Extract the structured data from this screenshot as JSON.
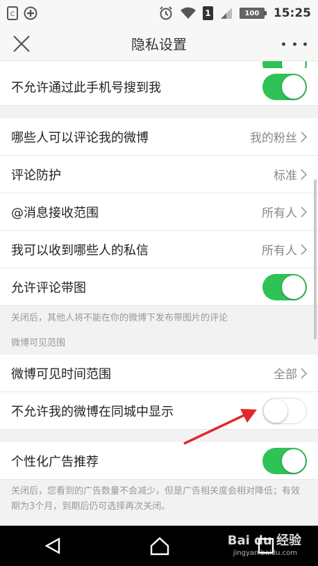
{
  "status_bar": {
    "time": "15:25",
    "battery": "100",
    "sim": "1"
  },
  "navbar": {
    "title": "隐私设置",
    "close_icon": "close-icon",
    "more_icon": "more-icon"
  },
  "settings": {
    "phone_search": {
      "label": "不允许通过此手机号搜到我",
      "toggle": true
    },
    "comment_who": {
      "label": "哪些人可以评论我的微博",
      "value": "我的粉丝"
    },
    "comment_protect": {
      "label": "评论防护",
      "value": "标准"
    },
    "mention_scope": {
      "label": "@消息接收范围",
      "value": "所有人"
    },
    "dm_scope": {
      "label": "我可以收到哪些人的私信",
      "value": "所有人"
    },
    "comment_image": {
      "label": "允许评论带图",
      "toggle": true
    },
    "comment_image_hint": "关闭后，其他人将不能在你的微博下发布带图片的评论",
    "weibo_visible_section": "微博可见范围",
    "visible_time": {
      "label": "微博可见时间范围",
      "value": "全部"
    },
    "city_hide": {
      "label": "不允许我的微博在同城中显示",
      "toggle": false
    },
    "ads": {
      "label": "个性化广告推荐",
      "toggle": true
    },
    "ads_hint": "关闭后，您看到的广告数量不会减少，但是广告相关度会相对降低；有效期为3个月，到期后仍可选择再次关闭。"
  },
  "watermark": {
    "text": "Bai du 经验",
    "sub": "jingyan.baidu.com"
  },
  "colors": {
    "toggle_on": "#2fc357",
    "arrow": "#e0282c"
  }
}
